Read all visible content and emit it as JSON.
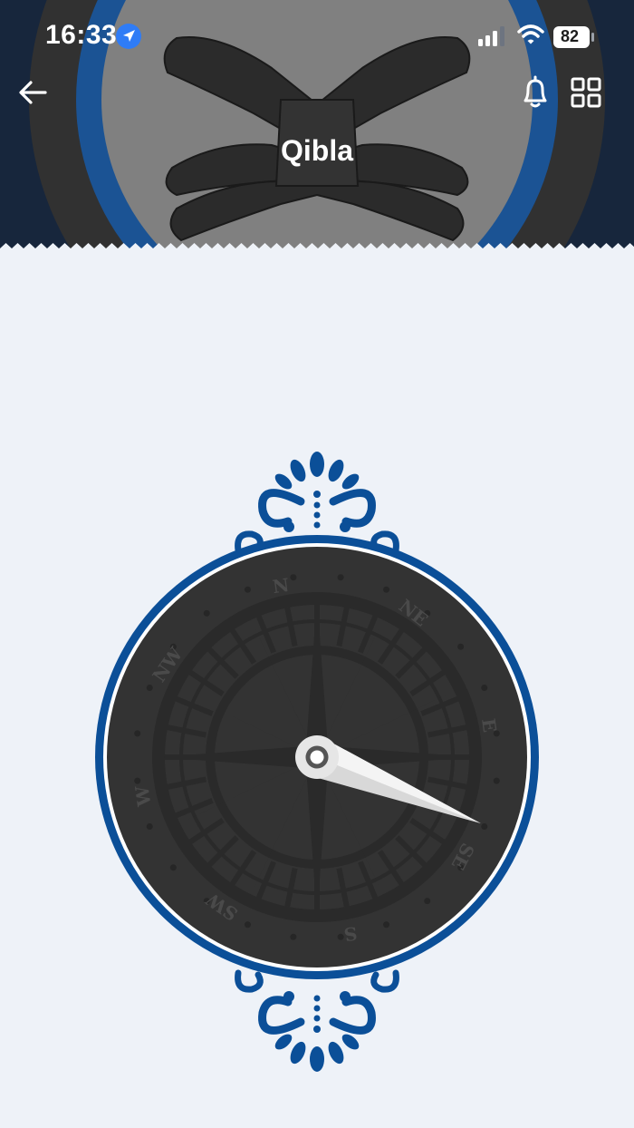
{
  "status_bar": {
    "time": "16:33",
    "battery_level": "82",
    "icons": [
      "location-arrow-icon",
      "cellular-signal-icon",
      "wifi-icon",
      "battery-icon"
    ]
  },
  "header": {
    "title": "Qibla",
    "background_image": "quran-stand-rehal",
    "icons": [
      "arrow-left-icon",
      "bell-icon",
      "grid-icon"
    ]
  },
  "compass": {
    "directions": {
      "n": "N",
      "ne": "NE",
      "e": "E",
      "se": "SE",
      "s": "S",
      "sw": "SW",
      "w": "W",
      "nw": "NW"
    },
    "needle_bearing_deg": 112
  },
  "colors": {
    "header_bg": "#17263c",
    "accent_blue": "#0b4f98",
    "compass_face": "#333333",
    "page_bg": "#eef2f8"
  }
}
